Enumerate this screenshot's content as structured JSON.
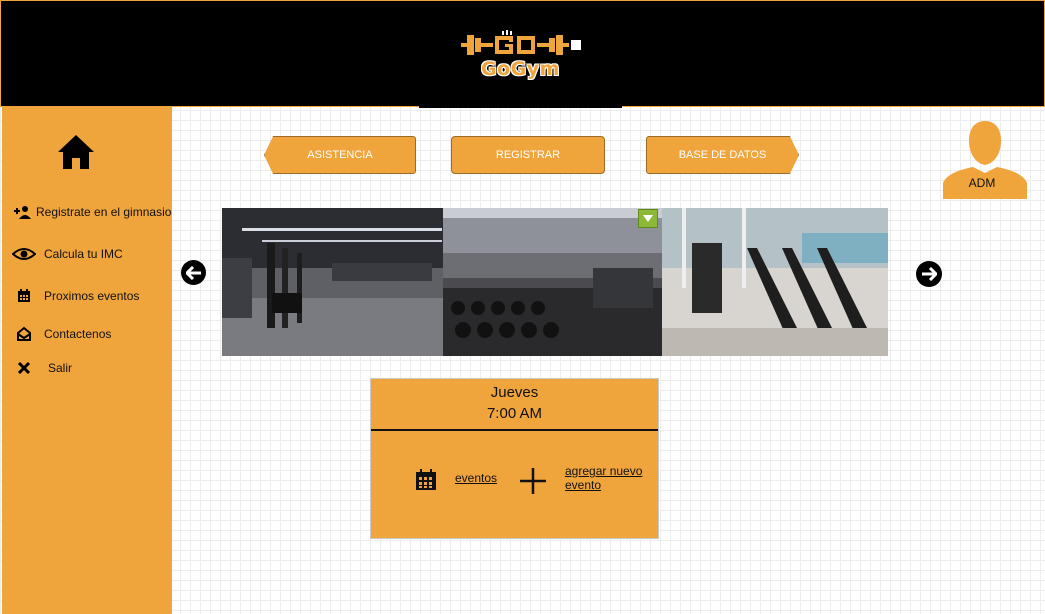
{
  "header": {
    "logo_text": "GoGym"
  },
  "sidebar": {
    "items": [
      {
        "label": "Registrate en el gimnasio",
        "icon": "add-user-icon"
      },
      {
        "label": "Calcula tu IMC",
        "icon": "eye-icon"
      },
      {
        "label": "Proximos eventos",
        "icon": "calendar-icon"
      },
      {
        "label": "Contactenos",
        "icon": "envelope-icon"
      },
      {
        "label": "Salir",
        "icon": "close-icon"
      }
    ]
  },
  "toolbar": {
    "asistencia_label": "ASISTENCIA",
    "registrar_label": "REGISTRAR",
    "base_label": "BASE DE DATOS"
  },
  "user": {
    "label": "ADM"
  },
  "event": {
    "day": "Jueves",
    "time": "7:00 AM",
    "events_link": "eventos",
    "add_link": "agregar nuevo evento"
  },
  "colors": {
    "accent": "#f0a43c",
    "header_bg": "#000000",
    "dropdown": "#8db83a"
  }
}
